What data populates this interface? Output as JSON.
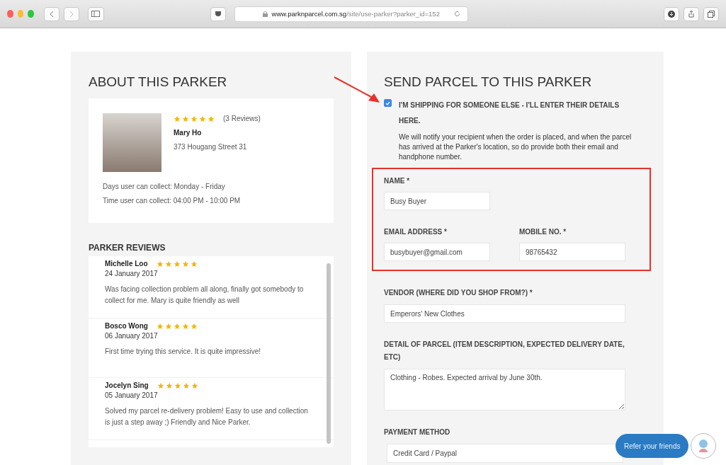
{
  "browser": {
    "url_host": "www.parknparcel.com.sg",
    "url_path": "/site/use-parker?parker_id=152"
  },
  "about": {
    "title": "ABOUT THIS PARKER",
    "stars": 5,
    "review_count": "(3 Reviews)",
    "name": "Mary Ho",
    "address": "373 Hougang Street 31",
    "days": "Days user can collect: Monday - Friday",
    "time": "Time user can collect: 04:00 PM - 10:00 PM"
  },
  "reviews": {
    "title": "PARKER REVIEWS",
    "items": [
      {
        "name": "Michelle Loo",
        "stars": 5,
        "date": "24 January 2017",
        "text": "Was facing collection problem all along, finally got somebody to collect for me. Mary is quite friendly as well"
      },
      {
        "name": "Bosco Wong",
        "stars": 5,
        "date": "06 January 2017",
        "text": "First time trying this service. It is quite impressive!"
      },
      {
        "name": "Jocelyn Sing",
        "stars": 5,
        "date": "05 January 2017",
        "text": "Solved my parcel re-delivery problem! Easy to use and collection is just a step away ;) Friendly and Nice Parker."
      }
    ]
  },
  "send": {
    "title": "SEND PARCEL TO THIS PARKER",
    "checkbox": {
      "label": "I'M SHIPPING FOR SOMEONE ELSE - I'LL ENTER THEIR DETAILS HERE.",
      "checked": true
    },
    "note": "We will notify your recipient when the order is placed, and when the parcel has arrived at the Parker's location, so do provide both their email and handphone number.",
    "name": {
      "label": "NAME *",
      "value": "Busy Buyer"
    },
    "email": {
      "label": "EMAIL ADDRESS *",
      "value": "busybuyer@gmail.com"
    },
    "mobile": {
      "label": "MOBILE NO. *",
      "value": "98765432"
    },
    "vendor": {
      "label": "VENDOR (WHERE DID YOU SHOP FROM?) *",
      "value": "Emperors' New Clothes"
    },
    "detail": {
      "label": "DETAIL OF PARCEL (ITEM DESCRIPTION, EXPECTED DELIVERY DATE, ETC)",
      "value": "Clothing - Robes. Expected arrival by June 30th."
    },
    "payment": {
      "label": "PAYMENT METHOD",
      "value": "Credit Card / Paypal"
    }
  },
  "refer": {
    "label": "Refer your friends"
  }
}
